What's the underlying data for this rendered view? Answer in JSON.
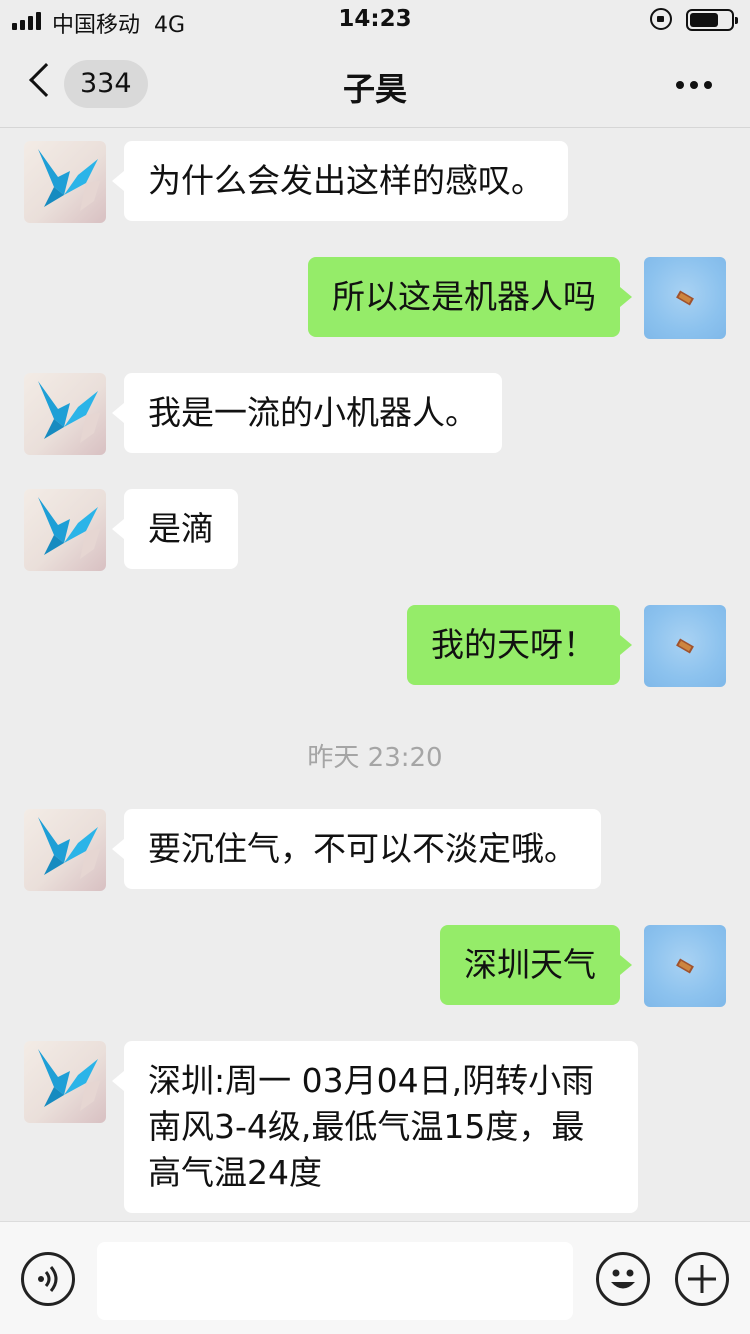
{
  "status_bar": {
    "carrier": "中国移动",
    "network": "4G",
    "time": "14:23"
  },
  "nav": {
    "unread_count": "334",
    "title": "子昊"
  },
  "messages": [
    {
      "side": "left",
      "text": "为什么会发出这样的感叹。"
    },
    {
      "side": "right",
      "text": "所以这是机器人吗"
    },
    {
      "side": "left",
      "text": "我是一流的小机器人。"
    },
    {
      "side": "left",
      "text": "是滴"
    },
    {
      "side": "right",
      "text": "我的天呀！"
    },
    {
      "side": "left",
      "text": "要沉住气，不可以不淡定哦。"
    },
    {
      "side": "right",
      "text": "深圳天气"
    },
    {
      "side": "left",
      "text": "深圳:周一 03月04日,阴转小雨\n南风3-4级,最低气温15度，最\n高气温24度"
    }
  ],
  "timestamp": "昨天 23:20",
  "input": {
    "value": ""
  },
  "colors": {
    "background": "#ededed",
    "sent_bubble": "#95ec69",
    "received_bubble": "#ffffff"
  }
}
